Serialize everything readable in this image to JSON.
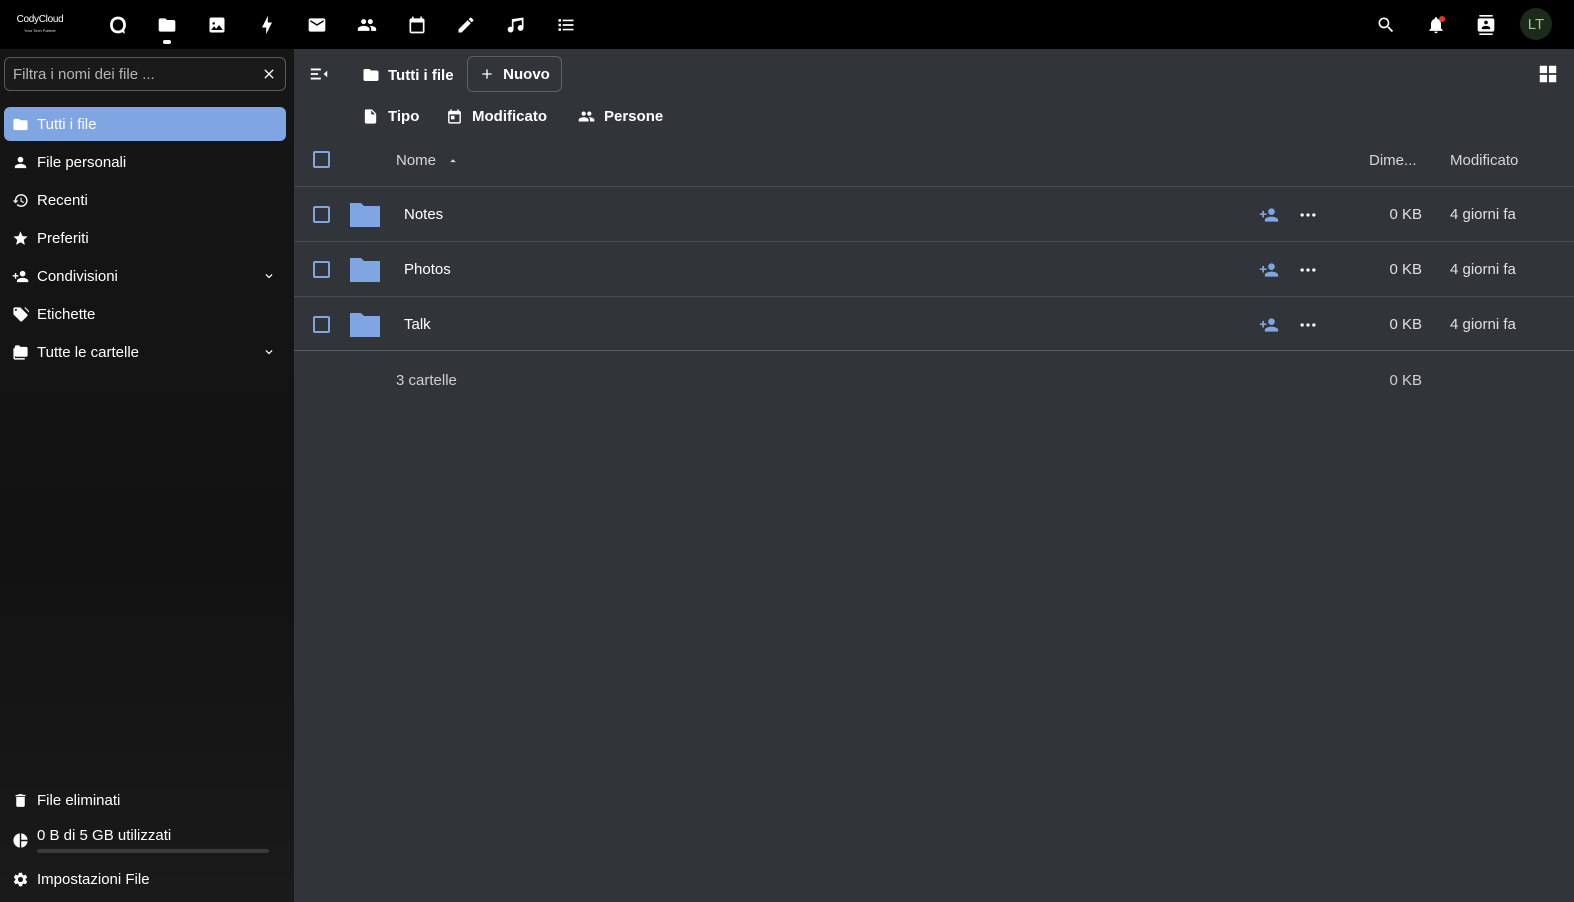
{
  "header": {
    "logo_name": "CodyCloud",
    "logo_tagline": "Your Tech Partner",
    "apps": [
      {
        "name": "Dashboard",
        "icon": "dashboard-icon"
      },
      {
        "name": "File",
        "icon": "files-icon",
        "active": true
      },
      {
        "name": "Foto",
        "icon": "photos-icon"
      },
      {
        "name": "Attività",
        "icon": "activity-icon"
      },
      {
        "name": "Posta",
        "icon": "mail-icon"
      },
      {
        "name": "Contatti",
        "icon": "contacts-icon"
      },
      {
        "name": "Calendario",
        "icon": "calendar-icon"
      },
      {
        "name": "Note",
        "icon": "pencil-icon"
      },
      {
        "name": "Musica",
        "icon": "music-icon"
      },
      {
        "name": "Attività",
        "icon": "tasks-icon"
      }
    ],
    "right_icons": [
      "search-icon",
      "notifications-icon",
      "contacts-menu-icon"
    ],
    "avatar_initials": "LT"
  },
  "sidebar": {
    "filter_placeholder": "Filtra i nomi dei file ...",
    "items": [
      {
        "label": "Tutti i file",
        "icon": "folder-icon",
        "active": true
      },
      {
        "label": "File personali",
        "icon": "person-icon"
      },
      {
        "label": "Recenti",
        "icon": "history-icon"
      },
      {
        "label": "Preferiti",
        "icon": "star-icon"
      },
      {
        "label": "Condivisioni",
        "icon": "share-icon",
        "expandable": true
      },
      {
        "label": "Etichette",
        "icon": "tag-icon"
      },
      {
        "label": "Tutte le cartelle",
        "icon": "folder-multiple-icon",
        "expandable": true
      }
    ],
    "trash_label": "File eliminati",
    "quota_label": "0 B di 5 GB utilizzati",
    "quota_used_fraction": 0,
    "settings_label": "Impostazioni File"
  },
  "main": {
    "breadcrumb": "Tutti i file",
    "new_button": "Nuovo",
    "filters": [
      {
        "label": "Tipo",
        "icon": "file-type-icon"
      },
      {
        "label": "Modificato",
        "icon": "calendar-icon"
      },
      {
        "label": "Persone",
        "icon": "people-icon"
      }
    ],
    "columns": {
      "name": "Nome",
      "size": "Dime...",
      "modified": "Modificato"
    },
    "rows": [
      {
        "name": "Notes",
        "size": "0 KB",
        "modified": "4 giorni fa"
      },
      {
        "name": "Photos",
        "size": "0 KB",
        "modified": "4 giorni fa"
      },
      {
        "name": "Talk",
        "size": "0 KB",
        "modified": "4 giorni fa"
      }
    ],
    "summary": {
      "label": "3 cartelle",
      "size": "0 KB"
    }
  },
  "colors": {
    "accent": "#7fa5e3",
    "main_bg": "#313438",
    "topbar_bg": "#000000"
  }
}
